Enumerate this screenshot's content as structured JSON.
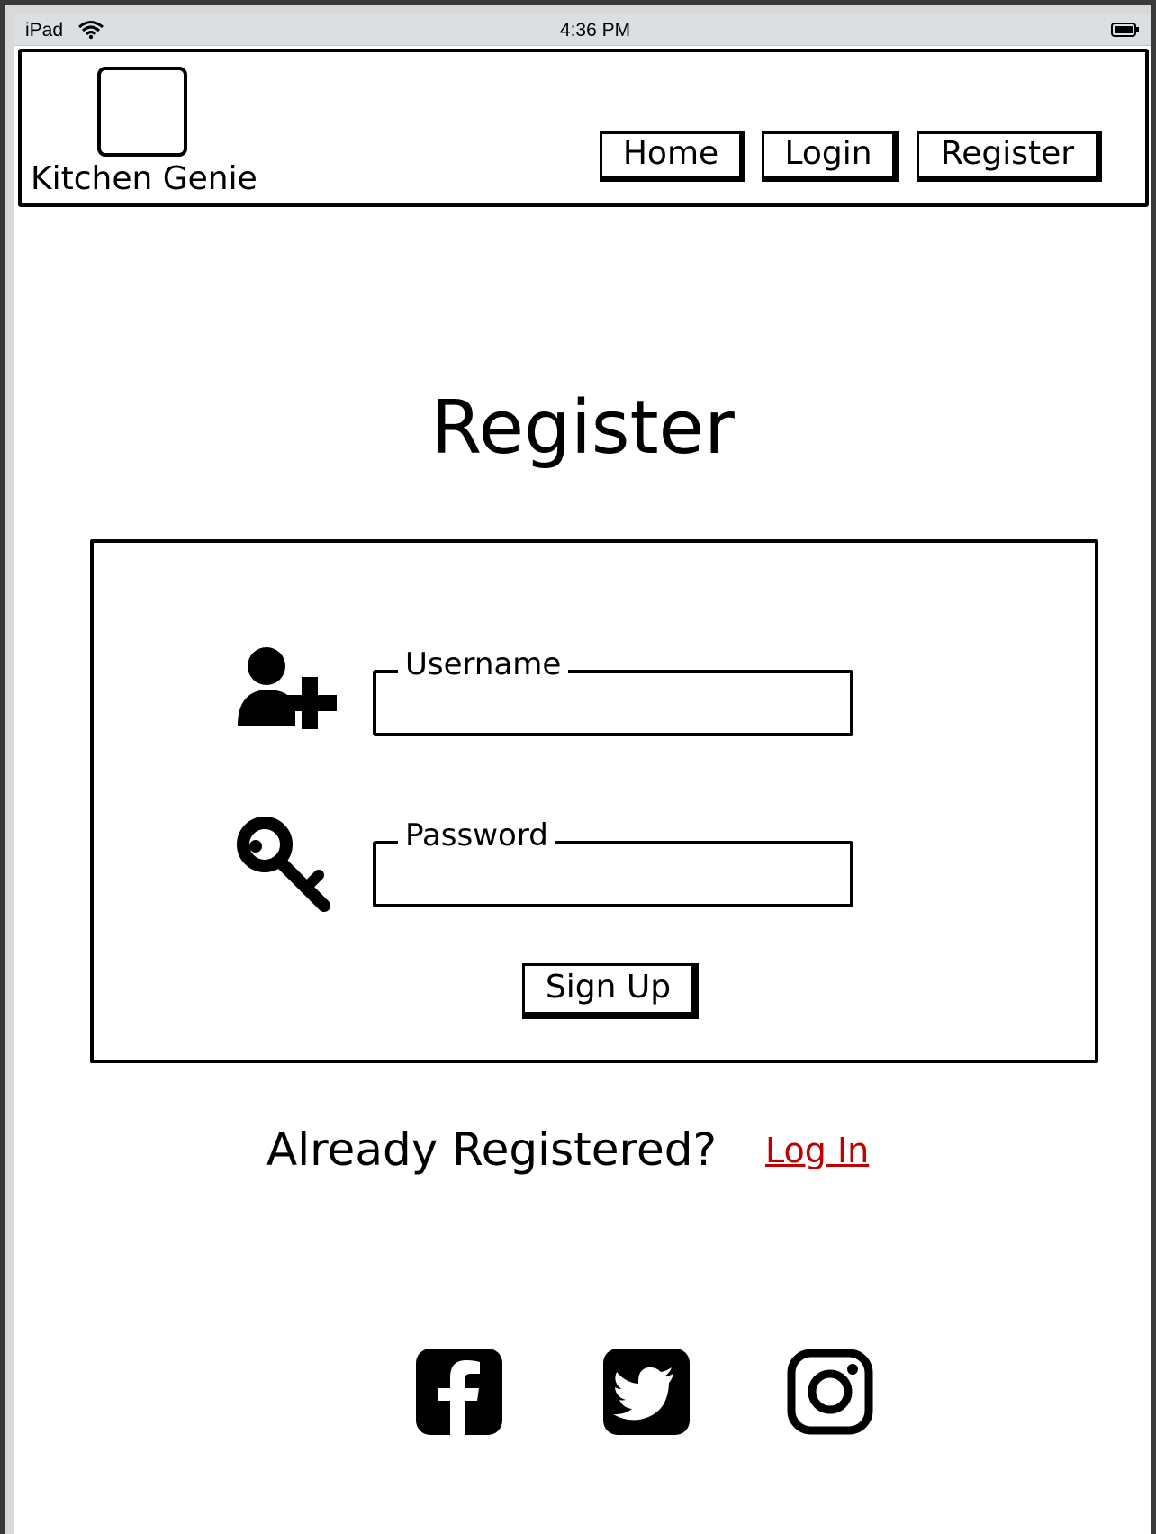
{
  "status_bar": {
    "device": "iPad",
    "time": "4:36 PM",
    "wifi_icon": "wifi-icon",
    "battery_icon": "battery-icon"
  },
  "header": {
    "logo_icon": "logo-placeholder",
    "brand": "Kitchen Genie",
    "nav": {
      "home": "Home",
      "login": "Login",
      "register": "Register"
    }
  },
  "main": {
    "title": "Register",
    "form": {
      "username": {
        "label": "Username",
        "value": "",
        "icon": "add-user-icon"
      },
      "password": {
        "label": "Password",
        "value": "",
        "icon": "key-icon"
      },
      "submit_label": "Sign Up"
    },
    "already_registered": "Already Registered?",
    "login_link": "Log In",
    "link_color": "#c00000"
  },
  "footer": {
    "social": [
      "facebook-icon",
      "twitter-icon",
      "instagram-icon"
    ]
  }
}
